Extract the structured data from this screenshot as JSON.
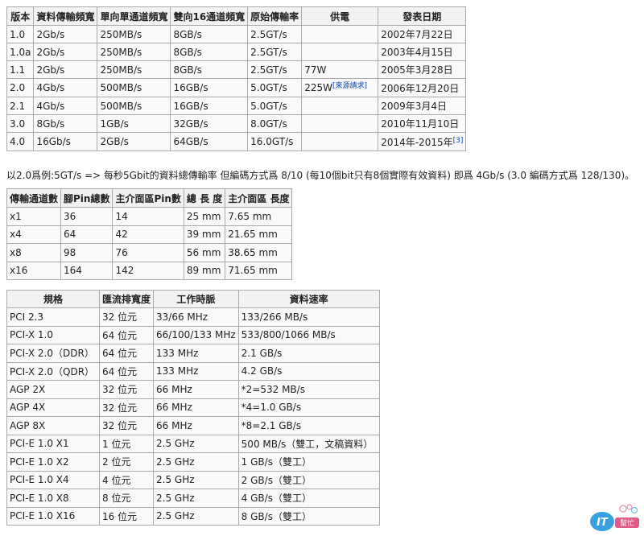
{
  "pcie_versions": {
    "headers": [
      "版本",
      "資料傳輸頻寬",
      "單向單通道頻寬",
      "雙向16通道頻寬",
      "原始傳輸率",
      "供電",
      "發表日期"
    ],
    "rows": [
      {
        "version": "1.0",
        "bandwidth": "2Gb/s",
        "single_lane": "250MB/s",
        "x16_dual": "8GB/s",
        "raw_rate": "2.5GT/s",
        "power": "",
        "power_note": "",
        "date": "2002年7月22日",
        "date_note": ""
      },
      {
        "version": "1.0a",
        "bandwidth": "2Gb/s",
        "single_lane": "250MB/s",
        "x16_dual": "8GB/s",
        "raw_rate": "2.5GT/s",
        "power": "",
        "power_note": "",
        "date": "2003年4月15日",
        "date_note": ""
      },
      {
        "version": "1.1",
        "bandwidth": "2Gb/s",
        "single_lane": "250MB/s",
        "x16_dual": "8GB/s",
        "raw_rate": "2.5GT/s",
        "power": "77W",
        "power_note": "",
        "date": "2005年3月28日",
        "date_note": ""
      },
      {
        "version": "2.0",
        "bandwidth": "4Gb/s",
        "single_lane": "500MB/s",
        "x16_dual": "16GB/s",
        "raw_rate": "5.0GT/s",
        "power": "225W",
        "power_note": "[來源請求]",
        "date": "2006年12月20日",
        "date_note": ""
      },
      {
        "version": "2.1",
        "bandwidth": "4Gb/s",
        "single_lane": "500MB/s",
        "x16_dual": "16GB/s",
        "raw_rate": "5.0GT/s",
        "power": "",
        "power_note": "",
        "date": "2009年3月4日",
        "date_note": ""
      },
      {
        "version": "3.0",
        "bandwidth": "8Gb/s",
        "single_lane": "1GB/s",
        "x16_dual": "32GB/s",
        "raw_rate": "8.0GT/s",
        "power": "",
        "power_note": "",
        "date": "2010年11月10日",
        "date_note": ""
      },
      {
        "version": "4.0",
        "bandwidth": "16Gb/s",
        "single_lane": "2GB/s",
        "x16_dual": "64GB/s",
        "raw_rate": "16.0GT/s",
        "power": "",
        "power_note": "",
        "date": "2014年-2015年",
        "date_note": "[3]"
      }
    ]
  },
  "note": "以2.0爲例:5GT/s => 每秒5Gbit的資料總傳輸率 但編碼方式爲 8/10 (每10個bit只有8個實際有效資料) 即爲 4Gb/s (3.0 編碼方式爲 128/130)。",
  "lanes": {
    "headers": [
      "傳輸通道數",
      "腳Pin總數",
      "主介面區Pin數",
      "總 長 度",
      "主介面區 長度"
    ],
    "rows": [
      {
        "lanes": "x1",
        "pins": "36",
        "main_pins": "14",
        "length": "25 mm",
        "main_length": "7.65 mm"
      },
      {
        "lanes": "x4",
        "pins": "64",
        "main_pins": "42",
        "length": "39 mm",
        "main_length": "21.65 mm"
      },
      {
        "lanes": "x8",
        "pins": "98",
        "main_pins": "76",
        "length": "56 mm",
        "main_length": "38.65 mm"
      },
      {
        "lanes": "x16",
        "pins": "164",
        "main_pins": "142",
        "length": "89 mm",
        "main_length": "71.65 mm"
      }
    ]
  },
  "bus_specs": {
    "headers": [
      "規格",
      "匯流排寬度",
      "工作時脈",
      "資料速率"
    ],
    "rows": [
      {
        "spec": "PCI 2.3",
        "width": "32 位元",
        "clock": "33/66 MHz",
        "rate": "133/266 MB/s"
      },
      {
        "spec": "PCI-X 1.0",
        "width": "64 位元",
        "clock": "66/100/133 MHz",
        "rate": "533/800/1066 MB/s"
      },
      {
        "spec": "PCI-X 2.0（DDR）",
        "width": "64 位元",
        "clock": "133 MHz",
        "rate": "2.1 GB/s"
      },
      {
        "spec": "PCI-X 2.0（QDR）",
        "width": "64 位元",
        "clock": "133 MHz",
        "rate": "4.2 GB/s"
      },
      {
        "spec": "AGP 2X",
        "width": "32 位元",
        "clock": "66 MHz",
        "rate": "*2=532 MB/s"
      },
      {
        "spec": "AGP 4X",
        "width": "32 位元",
        "clock": "66 MHz",
        "rate": "*4=1.0 GB/s"
      },
      {
        "spec": "AGP 8X",
        "width": "32 位元",
        "clock": "66 MHz",
        "rate": "*8=2.1 GB/s"
      },
      {
        "spec": "PCI-E 1.0 X1",
        "width": "1 位元",
        "clock": "2.5 GHz",
        "rate": "500 MB/s（雙工，文稿資料）"
      },
      {
        "spec": "PCI-E 1.0 X2",
        "width": "2 位元",
        "clock": "2.5 GHz",
        "rate": "1 GB/s（雙工）"
      },
      {
        "spec": "PCI-E 1.0 X4",
        "width": "4 位元",
        "clock": "2.5 GHz",
        "rate": "2 GB/s（雙工）"
      },
      {
        "spec": "PCI-E 1.0 X8",
        "width": "8 位元",
        "clock": "2.5 GHz",
        "rate": "4 GB/s（雙工）"
      },
      {
        "spec": "PCI-E 1.0 X16",
        "width": "16 位元",
        "clock": "2.5 GHz",
        "rate": "8 GB/s（雙工）"
      }
    ]
  },
  "watermark": {
    "text": "ITHelp 幫忙",
    "colors": {
      "primary": "#3aa0e0",
      "accent": "#e05a8a"
    }
  }
}
